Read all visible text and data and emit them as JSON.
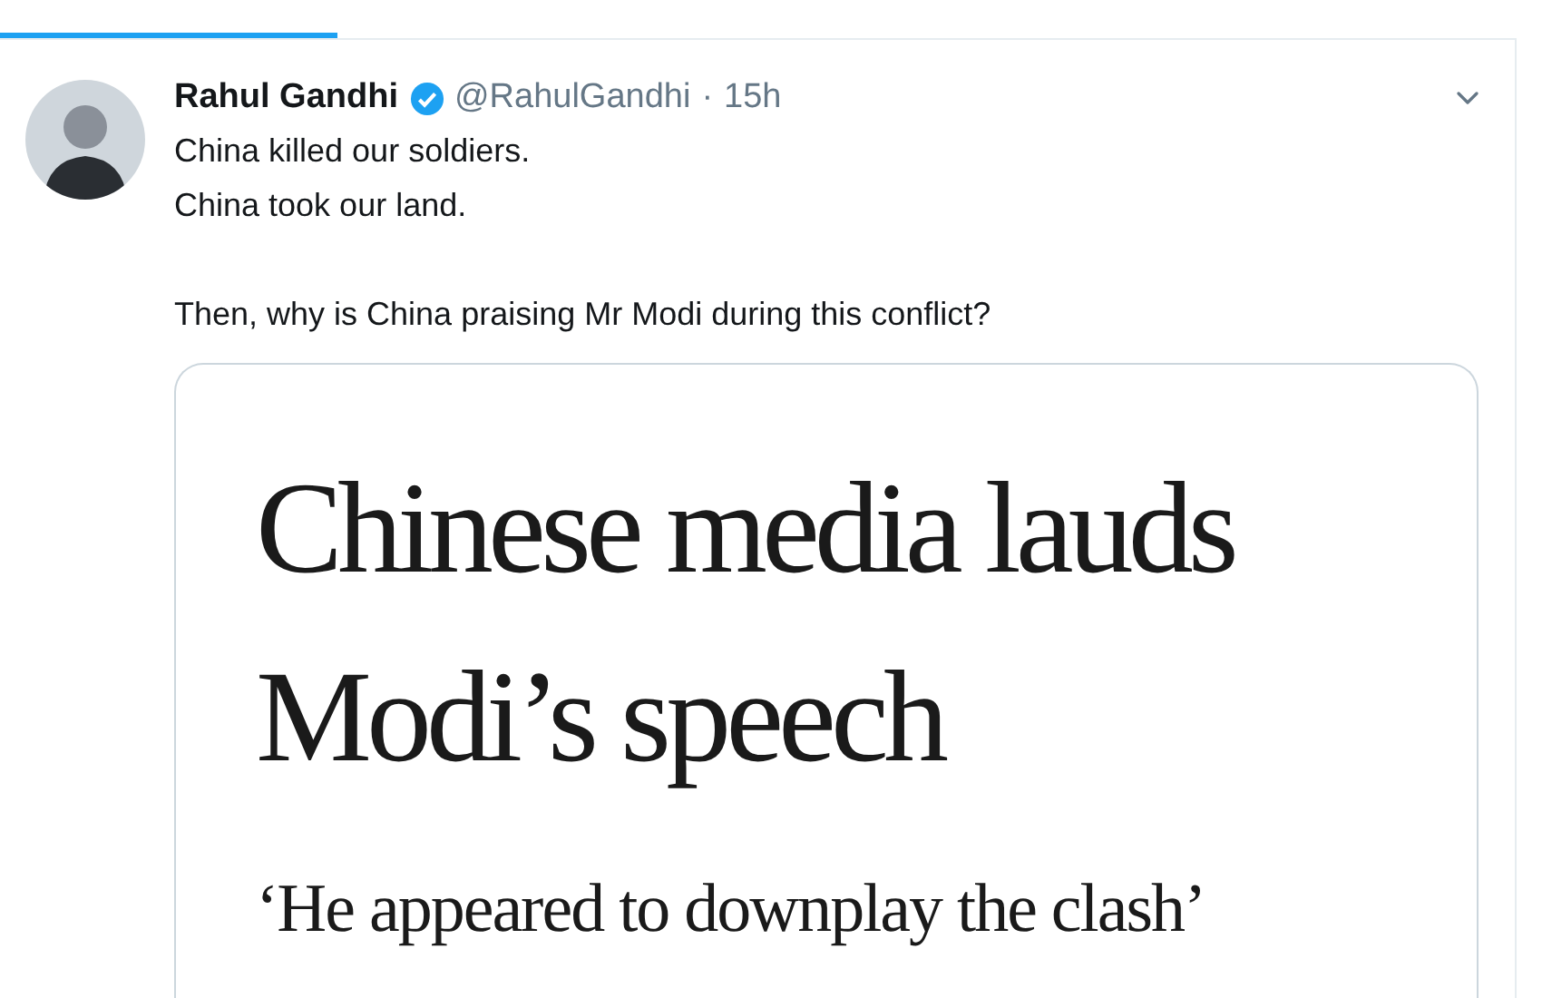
{
  "tabs": [
    {
      "selected": true
    }
  ],
  "tweet": {
    "name": "Rahul Gandhi",
    "verified": true,
    "handle": "@RahulGandhi",
    "separator": "·",
    "time": "15h",
    "paragraphs": [
      [
        "China killed our soldiers.",
        "China took our land."
      ],
      [
        "Then, why is China praising Mr Modi during this conflict?"
      ]
    ],
    "card": {
      "headline": [
        "Chinese media lauds",
        "Modi’s speech"
      ],
      "subhead": "‘He appeared to downplay the clash’"
    }
  }
}
